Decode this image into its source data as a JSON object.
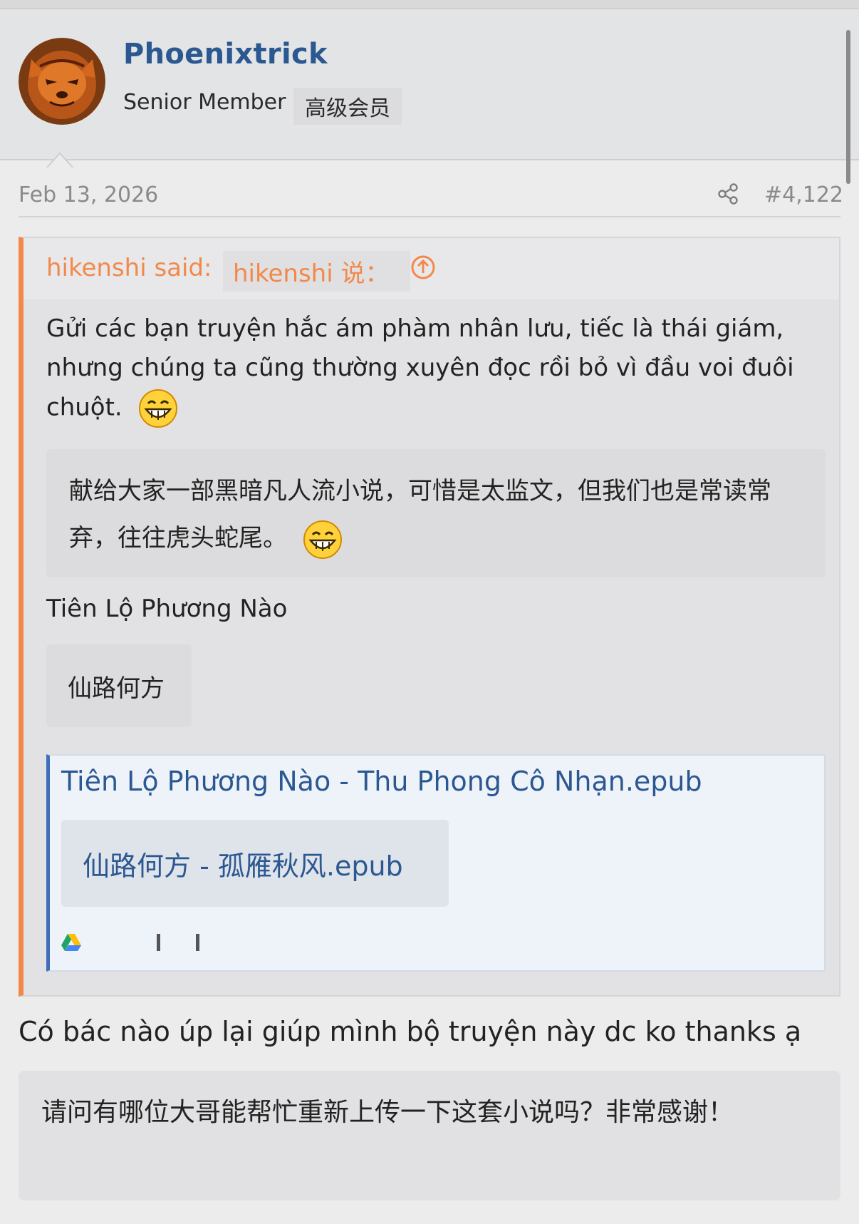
{
  "post_header": {
    "username": "Phoenixtrick",
    "role": "Senior Member",
    "role_translation": "高级会员",
    "avatar_icon": "fox-avatar-icon"
  },
  "post_meta": {
    "date": "Feb 13, 2026",
    "share_icon": "share-icon",
    "post_number": "#4,122"
  },
  "quote": {
    "author_said": "hikenshi said:",
    "author_said_translation": "hikenshi 说：",
    "jump_icon": "arrow-up-circle-icon",
    "text_vi": "Gửi các bạn truyện hắc ám phàm nhân lưu, tiếc là thái giám, nhưng chúng ta cũng thường xuyên đọc rồi bỏ vì đầu voi đuôi chuột.",
    "text_cn": "献给大家一部黑暗凡人流小说，可惜是太监文，但我们也是常读常弃，往往虎头蛇尾。",
    "title_vi": "Tiên Lộ Phương Nào",
    "title_cn": "仙路何方",
    "link": {
      "title": "Tiên Lộ Phương Nào - Thu Phong Cô Nhạn.epub",
      "title_translation": "仙路何方 - 孤雁秋风.epub",
      "provider_icon": "google-drive-icon"
    }
  },
  "reply": {
    "text_vi": "Có bác nào úp lại giúp mình bộ truyện này dc ko thanks ạ",
    "text_cn": "请问有哪位大哥能帮忙重新上传一下这套小说吗？非常感谢！"
  },
  "colors": {
    "username": "#2c5891",
    "quote_accent": "#f2894a",
    "link_accent": "#3e6fb8",
    "muted": "#8a8a8a"
  }
}
